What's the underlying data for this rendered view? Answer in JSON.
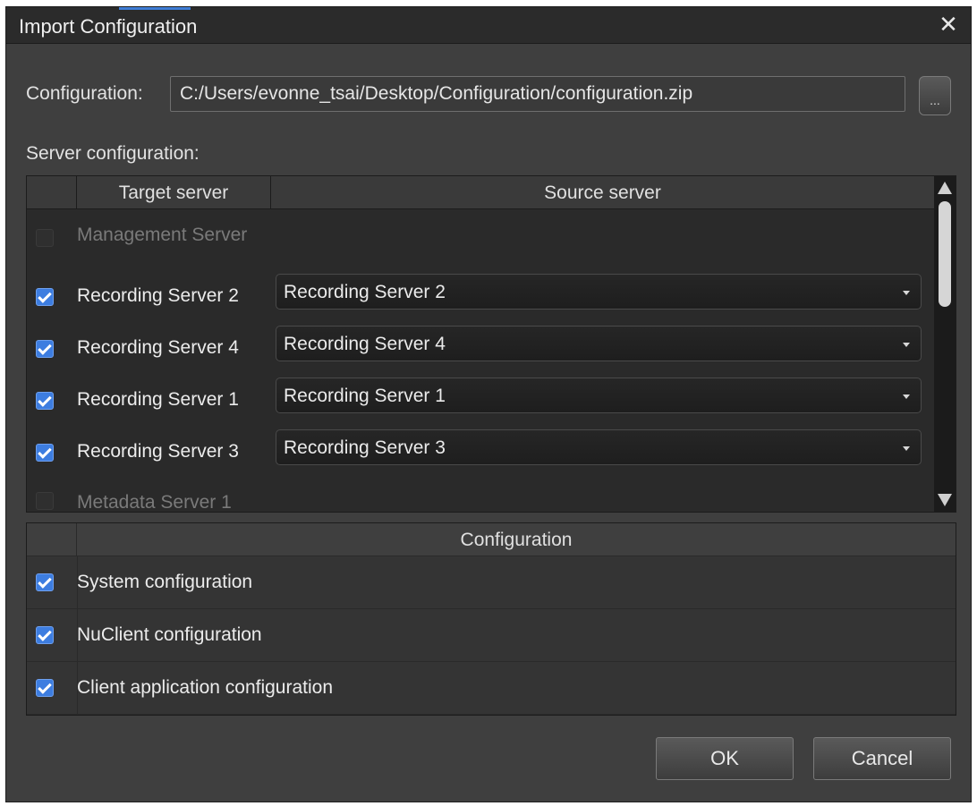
{
  "window": {
    "title": "Import Configuration",
    "close_glyph": "✕"
  },
  "configuration": {
    "label": "Configuration:",
    "path": "C:/Users/evonne_tsai/Desktop/Configuration/configuration.zip",
    "browse_label": "..."
  },
  "server_configuration": {
    "label": "Server configuration:",
    "columns": {
      "target": "Target server",
      "source": "Source server"
    },
    "rows": [
      {
        "target": "Management Server",
        "checked": false,
        "enabled": false,
        "source": ""
      },
      {
        "target": "Recording Server 2",
        "checked": true,
        "enabled": true,
        "source": "Recording Server 2"
      },
      {
        "target": "Recording Server 4",
        "checked": true,
        "enabled": true,
        "source": "Recording Server 4"
      },
      {
        "target": "Recording Server 1",
        "checked": true,
        "enabled": true,
        "source": "Recording Server 1"
      },
      {
        "target": "Recording Server 3",
        "checked": true,
        "enabled": true,
        "source": "Recording Server 3"
      },
      {
        "target": "Metadata Server 1",
        "checked": false,
        "enabled": false,
        "source": ""
      }
    ]
  },
  "configuration_section": {
    "header": "Configuration",
    "items": [
      {
        "label": "System configuration",
        "checked": true
      },
      {
        "label": "NuClient configuration",
        "checked": true
      },
      {
        "label": "Client application configuration",
        "checked": true
      }
    ]
  },
  "buttons": {
    "ok": "OK",
    "cancel": "Cancel"
  },
  "colors": {
    "accent": "#3d7de0",
    "dialog_bg": "#3f3f3f",
    "grid_bg": "#2a2a2a"
  }
}
